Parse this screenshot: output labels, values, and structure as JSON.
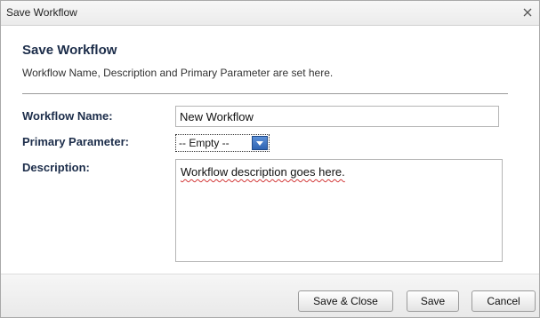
{
  "window": {
    "title": "Save Workflow",
    "close_icon": "close-icon"
  },
  "header": {
    "title": "Save Workflow",
    "subtitle": "Workflow Name, Description and Primary Parameter are set here."
  },
  "form": {
    "name_label": "Workflow Name:",
    "name_value": "New Workflow",
    "primary_label": "Primary Parameter:",
    "primary_selected": "-- Empty --",
    "description_label": "Description:",
    "description_value": "Workflow description goes here."
  },
  "footer": {
    "save_close_label": "Save & Close",
    "save_label": "Save",
    "cancel_label": "Cancel"
  },
  "colors": {
    "label_text": "#1c2d4a",
    "dropdown_arrow": "#2f64b3",
    "spellcheck_underline": "#d33b3b"
  }
}
